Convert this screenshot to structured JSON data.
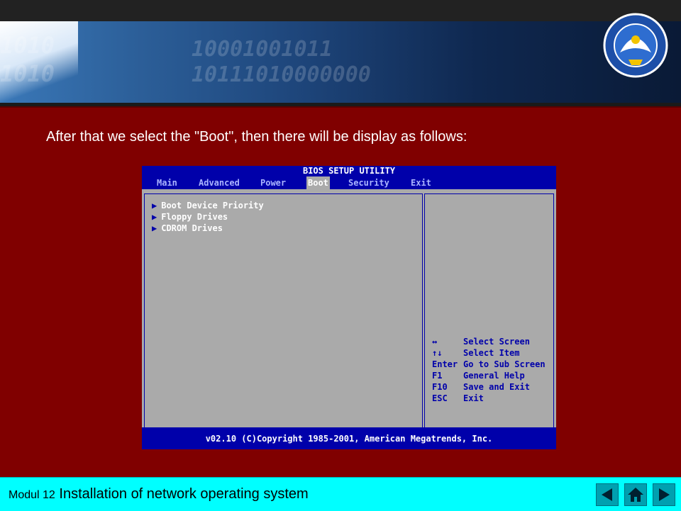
{
  "slide": {
    "heading": "After that we select the \"Boot\", then there will be display as follows:"
  },
  "banner": {
    "digits": [
      "1010",
      "10001001011",
      "1010",
      "10111010000000"
    ],
    "logo_text": "TUT WURI HANDAYANI"
  },
  "bios": {
    "title": "BIOS SETUP UTILITY",
    "menu": [
      "Main",
      "Advanced",
      "Power",
      "Boot",
      "Security",
      "Exit"
    ],
    "active_menu": "Boot",
    "items": [
      "Boot Device Priority",
      "Floppy Drives",
      "CDROM Drives"
    ],
    "help": [
      {
        "key": "↔",
        "desc": "Select Screen"
      },
      {
        "key": "↑↓",
        "desc": "Select Item"
      },
      {
        "key": "Enter",
        "desc": "Go to Sub Screen"
      },
      {
        "key": "F1",
        "desc": "General Help"
      },
      {
        "key": "F10",
        "desc": "Save and Exit"
      },
      {
        "key": "ESC",
        "desc": "Exit"
      }
    ],
    "footer": "v02.10 (C)Copyright 1985-2001, American Megatrends, Inc."
  },
  "footer": {
    "modul": "Modul 12",
    "title": "Installation of network operating system"
  },
  "nav": {
    "prev_icon": "triangle-left-icon",
    "home_icon": "home-icon",
    "next_icon": "triangle-right-icon"
  }
}
